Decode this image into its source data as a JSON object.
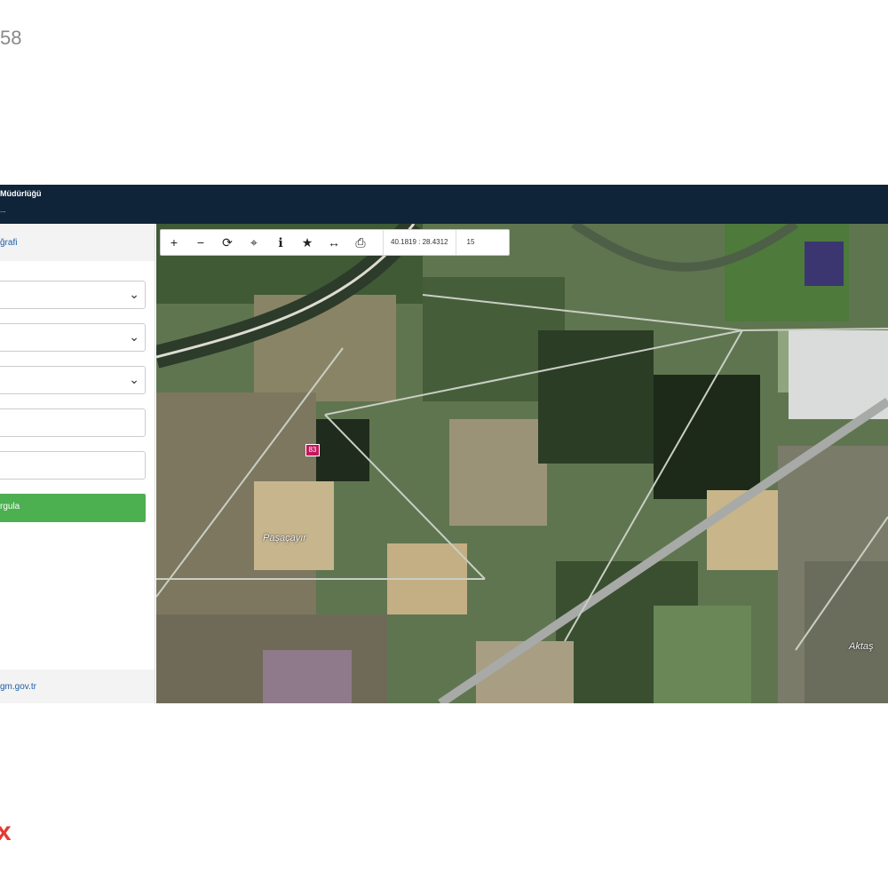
{
  "page": {
    "corner_number": "58",
    "corner_mark": "x"
  },
  "header": {
    "title": "Müdürlüğü",
    "subtitle": "..."
  },
  "sidebar": {
    "top_link": "ğrafi",
    "query_button": "rgula",
    "footer_link": "gm.gov.tr"
  },
  "toolbar": {
    "coordinates": "40.1819 : 28.4312",
    "zoom_level": "15"
  },
  "map": {
    "parcel_marker": "83",
    "place_label_1": "Paşaçayır",
    "place_label_2": "Aktaş"
  }
}
